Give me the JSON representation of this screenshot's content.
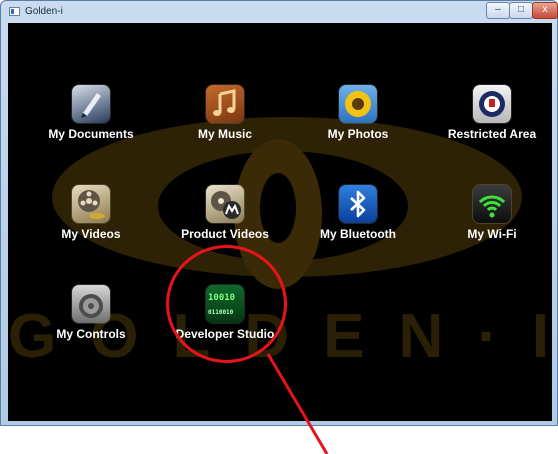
{
  "window": {
    "title": "Golden-i",
    "controls": {
      "minimize": "–",
      "maximize": "□",
      "close": "x"
    }
  },
  "background": {
    "watermark": "GOLDEN·I"
  },
  "apps": {
    "my_documents": "My Documents",
    "my_music": "My Music",
    "my_photos": "My Photos",
    "restricted_area": "Restricted Area",
    "my_videos": "My Videos",
    "product_videos": "Product Videos",
    "my_bluetooth": "My Bluetooth",
    "my_wifi": "My Wi-Fi",
    "my_controls": "My Controls",
    "developer_studio": "Developer Studio"
  },
  "developer_icon_text": {
    "line1": "10010",
    "line2": "0110010"
  },
  "annotation": {
    "color": "#e8131b"
  }
}
